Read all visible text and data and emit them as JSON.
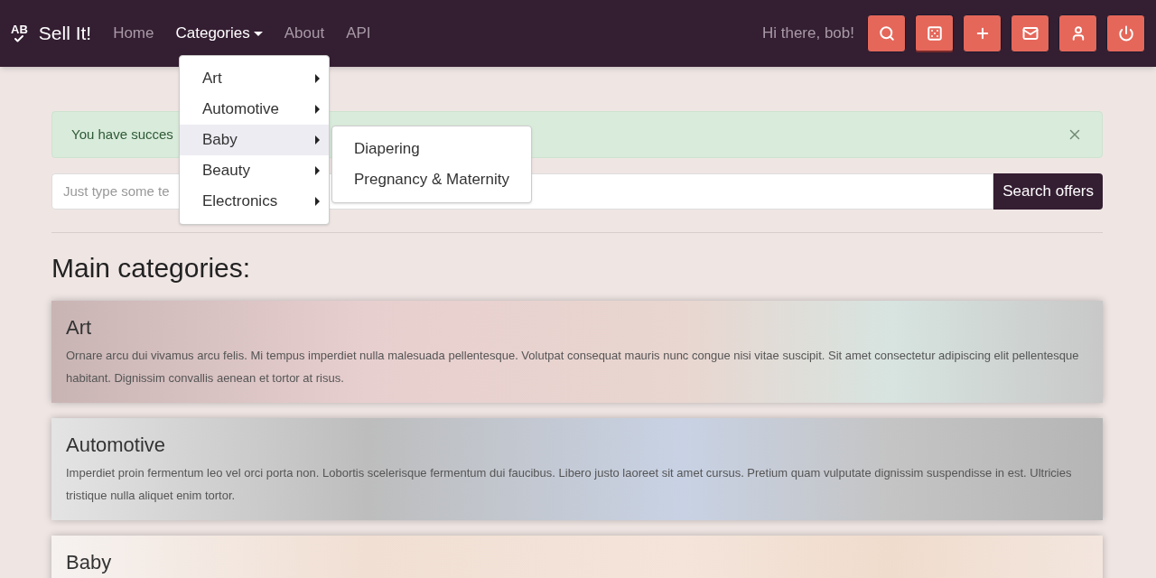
{
  "navbar": {
    "logo_text": "AB",
    "brand": "Sell It!",
    "links": [
      {
        "label": "Home",
        "selected": false,
        "dropdown": false
      },
      {
        "label": "Categories",
        "selected": true,
        "dropdown": true
      },
      {
        "label": "About",
        "selected": false,
        "dropdown": false
      },
      {
        "label": "API",
        "selected": false,
        "dropdown": false
      }
    ],
    "greeting": "Hi there, bob!",
    "buttons": [
      {
        "kind": "search",
        "selected": false
      },
      {
        "kind": "dice",
        "selected": true
      },
      {
        "kind": "plus",
        "selected": false
      },
      {
        "kind": "mail",
        "selected": false
      },
      {
        "kind": "user",
        "selected": false
      },
      {
        "kind": "power",
        "selected": false
      }
    ]
  },
  "dropdown": {
    "items": [
      {
        "label": "Art",
        "selected": false
      },
      {
        "label": "Automotive",
        "selected": false
      },
      {
        "label": "Baby",
        "selected": true
      },
      {
        "label": "Beauty",
        "selected": false
      },
      {
        "label": "Electronics",
        "selected": false
      }
    ],
    "submenu": [
      "Diapering",
      "Pregnancy & Maternity"
    ]
  },
  "alert": {
    "text": "You have succes"
  },
  "search": {
    "placeholder": "Just type some te",
    "button": "Search offers"
  },
  "heading": "Main categories:",
  "categories": [
    {
      "title": "Art",
      "description": "Ornare arcu dui vivamus arcu felis. Mi tempus imperdiet nulla malesuada pellentesque. Volutpat consequat mauris nunc congue nisi vitae suscipit. Sit amet consectetur adipiscing elit pellentesque habitant. Dignissim convallis aenean et tortor at risus."
    },
    {
      "title": "Automotive",
      "description": "Imperdiet proin fermentum leo vel orci porta non. Lobortis scelerisque fermentum dui faucibus. Libero justo laoreet sit amet cursus. Pretium quam vulputate dignissim suspendisse in est. Ultricies tristique nulla aliquet enim tortor."
    },
    {
      "title": "Baby"
    }
  ]
}
